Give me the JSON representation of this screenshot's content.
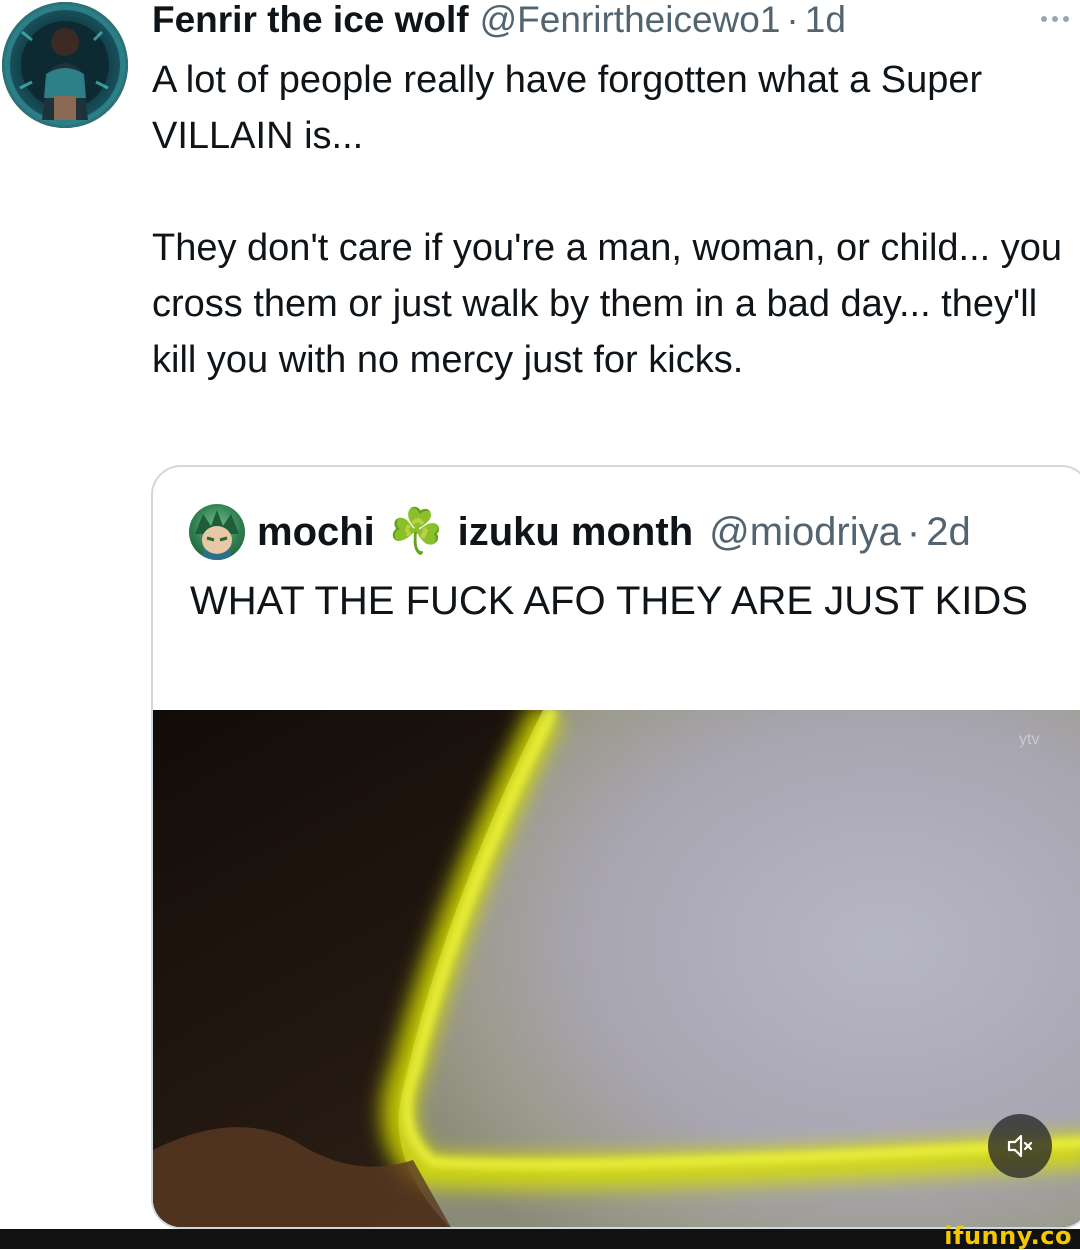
{
  "tweet": {
    "author_name": "Fenrir the ice wolf",
    "author_handle": "@Fenrirtheicewo1",
    "separator": "·",
    "time": "1d",
    "text_p1": "A lot of people really have forgotten what a Super VILLAIN is...",
    "text_p2": "They don't care if you're a man, woman, or child... you cross them or just walk by them in a bad day... they'll kill you with no mercy just for kicks.",
    "more_icon": "more-horizontal-icon"
  },
  "quoted": {
    "name_part1": "mochi",
    "name_emoji": "☘️",
    "name_part2": "izuku month",
    "handle": "@miodriya",
    "separator": "·",
    "time": "2d",
    "text": "WHAT THE FUCK AFO THEY ARE JUST KIDS",
    "video_watermark": "ytv",
    "mute_icon": "speaker-muted-icon"
  },
  "watermark": "ifunny.co",
  "colors": {
    "text_primary": "#0f1419",
    "text_secondary": "#536471",
    "border": "#cfd9de",
    "watermark": "#f6c800"
  }
}
